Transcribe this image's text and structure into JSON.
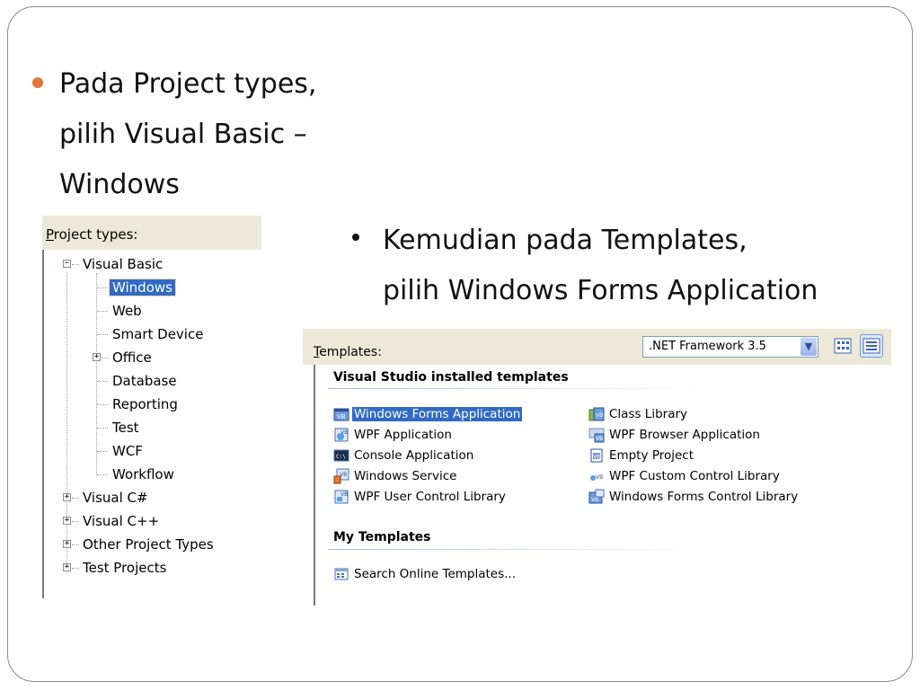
{
  "slide": {
    "bullet1_lines": [
      "Pada Project types,",
      "pilih Visual Basic –",
      "Windows"
    ],
    "bullet2_lines": [
      "Kemudian pada Templates,",
      "pilih Windows Forms Application"
    ],
    "accent_color": "#e2763c"
  },
  "project_types": {
    "label_accel": "P",
    "label_rest": "roject types:",
    "tree": {
      "visual_basic": "Visual Basic",
      "vb_children": [
        "Windows",
        "Web",
        "Smart Device",
        "Office",
        "Database",
        "Reporting",
        "Test",
        "WCF",
        "Workflow"
      ],
      "selected": "Windows",
      "others": [
        "Visual C#",
        "Visual C++",
        "Other Project Types",
        "Test Projects"
      ]
    }
  },
  "templates": {
    "label_accel": "T",
    "label_rest": "emplates:",
    "framework": ".NET Framework 3.5",
    "installed_heading": "Visual Studio installed templates",
    "installed_left": [
      "Windows Forms Application",
      "WPF Application",
      "Console Application",
      "Windows Service",
      "WPF User Control Library"
    ],
    "installed_right": [
      "Class Library",
      "WPF Browser Application",
      "Empty Project",
      "WPF Custom Control Library",
      "Windows Forms Control Library"
    ],
    "selected": "Windows Forms Application",
    "my_heading": "My Templates",
    "my_items": [
      "Search Online Templates..."
    ],
    "selection_color": "#316ac5"
  }
}
